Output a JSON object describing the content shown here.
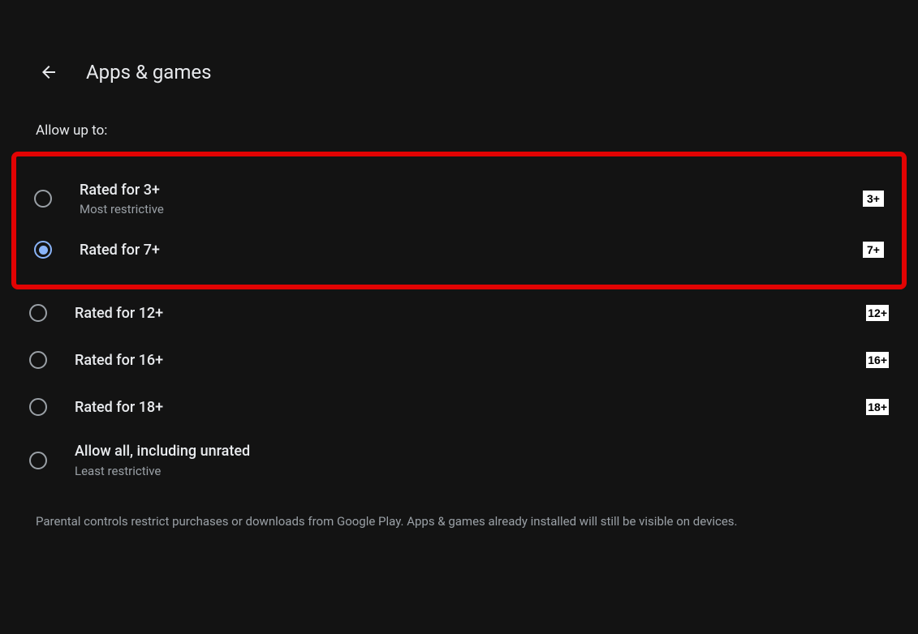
{
  "header": {
    "title": "Apps & games"
  },
  "subtitle": "Allow up to:",
  "options": [
    {
      "label": "Rated for 3+",
      "sub": "Most restrictive",
      "badge": "3+",
      "selected": false
    },
    {
      "label": "Rated for 7+",
      "sub": "",
      "badge": "7+",
      "selected": true
    },
    {
      "label": "Rated for 12+",
      "sub": "",
      "badge": "12+",
      "selected": false
    },
    {
      "label": "Rated for 16+",
      "sub": "",
      "badge": "16+",
      "selected": false
    },
    {
      "label": "Rated for 18+",
      "sub": "",
      "badge": "18+",
      "selected": false
    },
    {
      "label": "Allow all, including unrated",
      "sub": "Least restrictive",
      "badge": "",
      "selected": false
    }
  ],
  "footer": "Parental controls restrict purchases or downloads from Google Play. Apps & games already installed will still be visible on devices.",
  "highlight": {
    "start_index": 0,
    "end_index": 1
  }
}
